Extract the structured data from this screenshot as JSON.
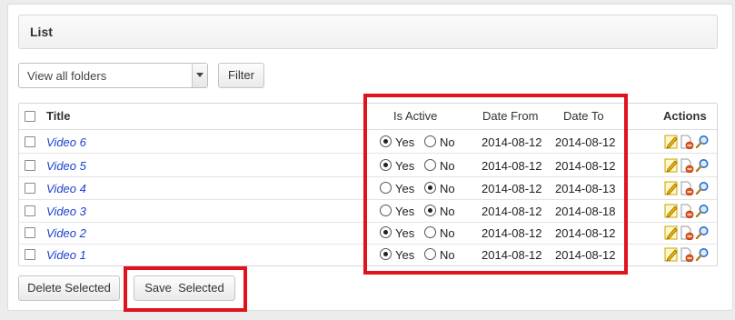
{
  "list": {
    "title": "List"
  },
  "toolbar": {
    "folder_select_value": "View all folders",
    "filter_label": "Filter"
  },
  "table": {
    "columns": {
      "title": "Title",
      "is_active": "Is Active",
      "date_from": "Date From",
      "date_to": "Date To",
      "actions": "Actions"
    },
    "yes_label": "Yes",
    "no_label": "No",
    "rows": [
      {
        "title": "Video 6",
        "active": "yes",
        "date_from": "2014-08-12",
        "date_to": "2014-08-12"
      },
      {
        "title": "Video 5",
        "active": "yes",
        "date_from": "2014-08-12",
        "date_to": "2014-08-12"
      },
      {
        "title": "Video 4",
        "active": "no",
        "date_from": "2014-08-12",
        "date_to": "2014-08-13"
      },
      {
        "title": "Video 3",
        "active": "no",
        "date_from": "2014-08-12",
        "date_to": "2014-08-18"
      },
      {
        "title": "Video 2",
        "active": "yes",
        "date_from": "2014-08-12",
        "date_to": "2014-08-12"
      },
      {
        "title": "Video 1",
        "active": "yes",
        "date_from": "2014-08-12",
        "date_to": "2014-08-12"
      }
    ],
    "row_actions": [
      "edit-icon",
      "delete-document-icon",
      "view-magnifier-icon"
    ]
  },
  "footer": {
    "delete_label": "Delete Selected",
    "save_label": "Save  Selected"
  },
  "colors": {
    "highlight_red": "#e0121b",
    "link_blue": "#1a3fd0"
  }
}
